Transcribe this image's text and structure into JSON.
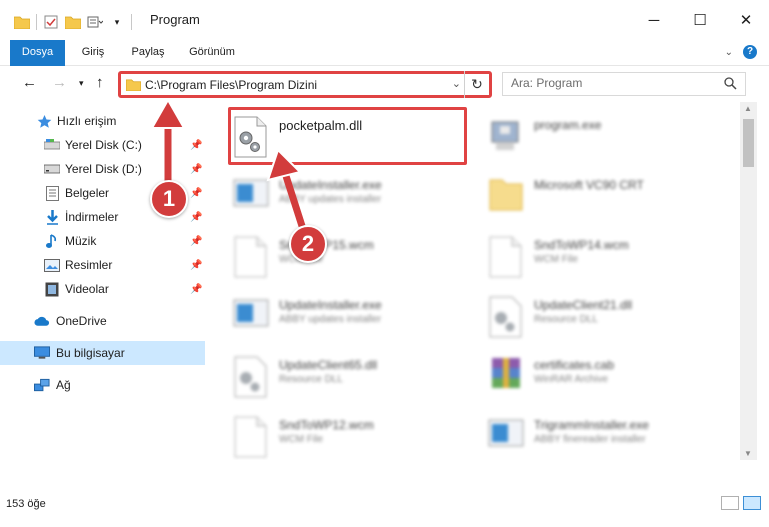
{
  "window": {
    "title": "Program",
    "controls": {
      "minimize": "─",
      "maximize": "☐",
      "close": "✕"
    }
  },
  "ribbon": {
    "tabs": [
      "Dosya",
      "Giriş",
      "Paylaş",
      "Görünüm"
    ],
    "help": "?"
  },
  "address": {
    "path": "C:\\Program Files\\Program Dizini"
  },
  "search": {
    "placeholder": "Ara: Program"
  },
  "sidebar": {
    "items": [
      {
        "label": "Hızlı erişim",
        "icon": "star-icon"
      },
      {
        "label": "Yerel Disk (C:)",
        "icon": "drive-icon"
      },
      {
        "label": "Yerel Disk (D:)",
        "icon": "drive-icon"
      },
      {
        "label": "Belgeler",
        "icon": "documents-icon"
      },
      {
        "label": "İndirmeler",
        "icon": "downloads-icon"
      },
      {
        "label": "Müzik",
        "icon": "music-icon"
      },
      {
        "label": "Resimler",
        "icon": "pictures-icon"
      },
      {
        "label": "Videolar",
        "icon": "videos-icon"
      },
      {
        "label": "OneDrive",
        "icon": "cloud-icon"
      },
      {
        "label": "Bu bilgisayar",
        "icon": "computer-icon"
      },
      {
        "label": "Ağ",
        "icon": "network-icon"
      }
    ]
  },
  "files": [
    {
      "name": "pocketpalm.dll",
      "type": "",
      "icon": "dll-gear-icon",
      "highlighted": true
    },
    {
      "name": "program.exe",
      "type": "",
      "icon": "exe-icon"
    },
    {
      "name": "UpdateInstaller.exe",
      "type": "ABBY updates installer",
      "icon": "installer-icon"
    },
    {
      "name": "Microsoft VC90 CRT",
      "type": "",
      "icon": "folder-icon"
    },
    {
      "name": "SndToWP15.wcm",
      "type": "WCM File",
      "icon": "blank-file-icon"
    },
    {
      "name": "SndToWP14.wcm",
      "type": "WCM File",
      "icon": "blank-file-icon"
    },
    {
      "name": "UpdateInstaller.exe",
      "type": "ABBY updates installer",
      "icon": "installer-icon"
    },
    {
      "name": "UpdateClient21.dll",
      "type": "Resource DLL",
      "icon": "dll-gear-icon"
    },
    {
      "name": "UpdateClient65.dll",
      "type": "Resource DLL",
      "icon": "dll-gear-icon"
    },
    {
      "name": "certificates.cab",
      "type": "WinRAR Archive",
      "icon": "archive-icon"
    },
    {
      "name": "SndToWP12.wcm",
      "type": "WCM File",
      "icon": "blank-file-icon"
    },
    {
      "name": "TrigrammInstaller.exe",
      "type": "ABBY finereader installer",
      "icon": "installer-icon"
    }
  ],
  "status": {
    "count": "153 öğe"
  },
  "markers": [
    "1",
    "2"
  ],
  "colors": {
    "accent": "#1979ca",
    "highlight": "#e04343",
    "selected": "#cce8ff"
  }
}
